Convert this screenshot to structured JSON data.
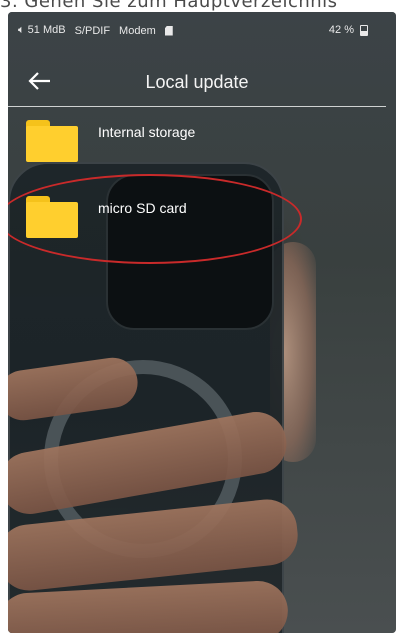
{
  "caption": "3.  Gehen Sie zum Hauptverzeichnis",
  "status_bar": {
    "volume": "51 MdB",
    "spdif": "S/PDIF",
    "modem": "Modem",
    "battery": "42 %"
  },
  "app_bar": {
    "title": "Local update",
    "back_icon": "arrow-left-icon"
  },
  "storage_list": [
    {
      "label": "Internal storage",
      "icon": "folder-icon"
    },
    {
      "label": "micro SD card",
      "icon": "folder-icon"
    }
  ],
  "highlight": {
    "target": "micro SD card",
    "color": "#c92a2a"
  },
  "colors": {
    "folder": "#ffcf2e",
    "screen_bg": "#3c4347",
    "text": "#ffffff"
  }
}
